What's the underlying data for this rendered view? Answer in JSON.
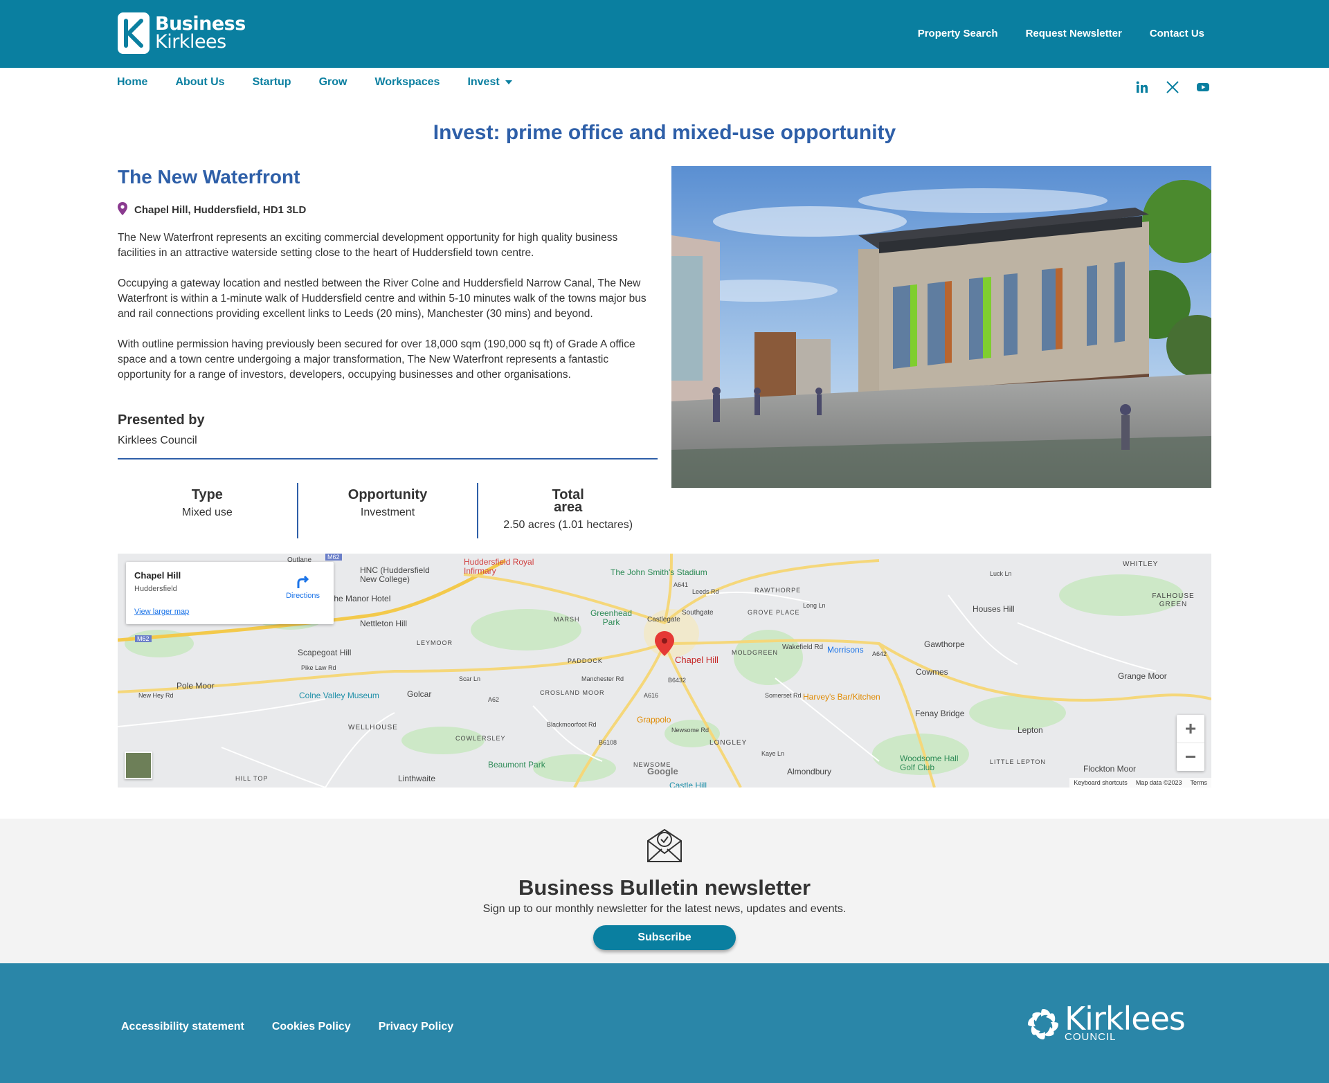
{
  "header": {
    "logo_line1": "Business",
    "logo_line2": "Kirklees",
    "top_links": [
      "Property Search",
      "Request Newsletter",
      "Contact Us"
    ]
  },
  "nav": {
    "items": [
      "Home",
      "About Us",
      "Startup",
      "Grow",
      "Workspaces",
      "Invest"
    ],
    "social": [
      "linkedin-icon",
      "x-icon",
      "youtube-icon"
    ]
  },
  "page": {
    "title": "Invest: prime office and mixed-use opportunity",
    "property_title": "The New Waterfront",
    "address": "Chapel Hill, Huddersfield, HD1 3LD",
    "paragraphs": [
      "The New Waterfront represents an exciting commercial development opportunity for high quality business facilities in an attractive waterside setting close to the heart of Huddersfield town centre.",
      "Occupying a gateway location and nestled between the River Colne and Huddersfield Narrow Canal, The New Waterfront is within a 1-minute walk of Huddersfield centre and within 5-10 minutes walk of the towns major bus and rail connections providing excellent links to Leeds (20 mins), Manchester (30 mins) and beyond.",
      "With outline permission having previously been secured for over 18,000 sqm (190,000 sq ft) of Grade A office space and a town centre undergoing a major transformation, The New Waterfront represents a fantastic opportunity for a range of investors, developers, occupying businesses and other organisations."
    ],
    "presented_label": "Presented by",
    "presented_value": "Kirklees Council",
    "stats": [
      {
        "key": "Type",
        "value": "Mixed use"
      },
      {
        "key": "Opportunity",
        "value": "Investment"
      },
      {
        "key_line1": "Total",
        "key_line2": "area",
        "value": "2.50 acres (1.01 hectares)"
      }
    ]
  },
  "map": {
    "card_title": "Chapel Hill",
    "card_sub": "Huddersfield",
    "directions": "Directions",
    "larger": "View larger map",
    "pin_label": "Chapel Hill",
    "places": [
      "Huddersfield Royal Infirmary",
      "The John Smith's Stadium",
      "HNC (Huddersfield New College)",
      "The Manor Hotel",
      "Nettleton Hill",
      "Scapegoat Hill",
      "Pole Moor",
      "Colne Valley Museum",
      "Golcar",
      "WELLHOUSE",
      "COWLERSLEY",
      "Linthwaite",
      "HILL TOP",
      "Beaumont Park",
      "Grappolo",
      "LONGLEY",
      "Almondbury",
      "Castle Hill",
      "Woodsome Hall Golf Club",
      "Harvey's Bar/Kitchen",
      "Fenay Bridge",
      "Lepton",
      "LITTLE LEPTON",
      "Flockton Moor",
      "Cowmes",
      "Gawthorpe",
      "Houses Hill",
      "Grange Moor",
      "FALHOUSE GREEN",
      "WHITLEY",
      "Morrisons",
      "MOLDGREEN",
      "GROVE PLACE",
      "RAWTHORPE",
      "Greenhead Park",
      "MARSH",
      "LEYMOOR",
      "PADDOCK",
      "CROSLAND MOOR",
      "NEWSOME"
    ],
    "road_labels": [
      "M62",
      "A62",
      "A616",
      "A641",
      "A642",
      "B6432",
      "B6108",
      "Southgate",
      "Castlegate",
      "Leeds Rd",
      "Wakefield Rd",
      "Manchester Rd",
      "Scar Ln",
      "Pike Law Rd",
      "New Hey Rd",
      "Blackmoorfoot Rd",
      "Newsome Rd",
      "Kaye Ln",
      "Long Ln",
      "Somerset Rd",
      "Luck Ln",
      "Outlane"
    ],
    "footer": [
      "Keyboard shortcuts",
      "Map data ©2023",
      "Terms"
    ],
    "zoom_in": "+",
    "zoom_out": "−",
    "google": "Google"
  },
  "newsletter": {
    "title": "Business Bulletin newsletter",
    "subtitle": "Sign up to our monthly newsletter for the latest news, updates and events.",
    "button": "Subscribe"
  },
  "footer": {
    "links": [
      "Accessibility statement",
      "Cookies Policy",
      "Privacy Policy"
    ],
    "logo_name": "Kirklees",
    "logo_sub": "COUNCIL"
  },
  "colors": {
    "brand": "#0a7fa0",
    "heading": "#2e5fa8",
    "footer": "#2a86a8"
  }
}
